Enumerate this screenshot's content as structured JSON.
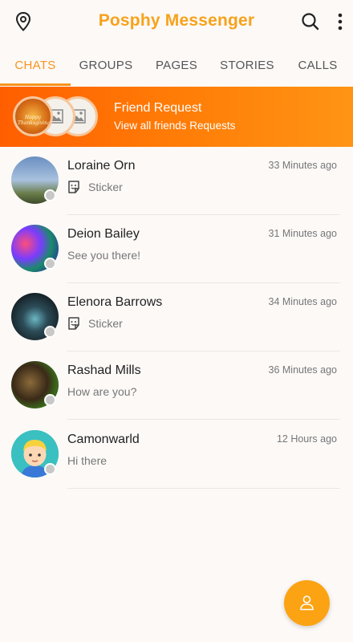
{
  "app": {
    "title": "Posphy Messenger"
  },
  "colors": {
    "accent": "#f7941d",
    "title": "#f7a21b",
    "banner_start": "#ff5e00",
    "banner_end": "#ff9414",
    "fab": "#fca313"
  },
  "icons": {
    "location": "location-pin-icon",
    "search": "search-icon",
    "more": "more-vertical-icon",
    "sticker": "sticker-icon",
    "add_contact": "user-icon"
  },
  "tabs": [
    {
      "label": "CHATS",
      "active": true
    },
    {
      "label": "GROUPS",
      "active": false
    },
    {
      "label": "PAGES",
      "active": false
    },
    {
      "label": "STORIES",
      "active": false
    },
    {
      "label": "CALLS",
      "active": false
    }
  ],
  "friend_request": {
    "title": "Friend Request",
    "subtitle": "View all friends Requests",
    "avatar_caption": "Happy Thanksgiving"
  },
  "chats": [
    {
      "name": "Loraine Orn",
      "time": "33 Minutes ago",
      "message": "Sticker",
      "has_sticker": true
    },
    {
      "name": "Deion Bailey",
      "time": "31 Minutes ago",
      "message": "See you there!",
      "has_sticker": false
    },
    {
      "name": "Elenora Barrows",
      "time": "34 Minutes ago",
      "message": "Sticker",
      "has_sticker": true
    },
    {
      "name": "Rashad Mills",
      "time": "36 Minutes ago",
      "message": "How are you?",
      "has_sticker": false
    },
    {
      "name": "Camonwarld",
      "time": "12 Hours ago",
      "message": "Hi there",
      "has_sticker": false
    }
  ]
}
